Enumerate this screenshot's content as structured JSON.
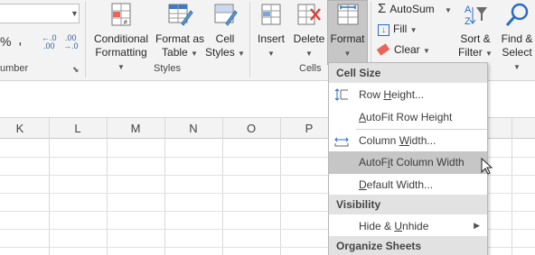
{
  "ribbon": {
    "number": {
      "percent": "%",
      "comma": ",",
      "increase_decimal_top": "←.0",
      "increase_decimal_bottom": ".00",
      "decrease_decimal_top": ".00",
      "decrease_decimal_bottom": "→.0",
      "group_label": "umber"
    },
    "styles": {
      "conditional_formatting": [
        "Conditional",
        "Formatting"
      ],
      "format_as_table": [
        "Format as",
        "Table"
      ],
      "cell_styles": [
        "Cell",
        "Styles"
      ],
      "group_label": "Styles"
    },
    "cells": {
      "insert": "Insert",
      "delete": "Delete",
      "format": "Format",
      "group_label": "Cells"
    },
    "editing": {
      "autosum": "AutoSum",
      "fill": "Fill",
      "clear": "Clear",
      "sort_filter": [
        "Sort &",
        "Filter"
      ],
      "find_select": [
        "Find &",
        "Select"
      ]
    }
  },
  "columns": [
    "K",
    "L",
    "M",
    "N",
    "O",
    "P"
  ],
  "format_menu": {
    "section_cell_size": "Cell Size",
    "row_height": {
      "pre": "Row ",
      "key": "H",
      "post": "eight..."
    },
    "autofit_row_height": {
      "pre": "",
      "key": "A",
      "post": "utoFit Row Height"
    },
    "column_width": {
      "pre": "Column ",
      "key": "W",
      "post": "idth..."
    },
    "autofit_column_width": {
      "pre": "AutoF",
      "key": "i",
      "post": "t Column Width"
    },
    "default_width": {
      "pre": "",
      "key": "D",
      "post": "efault Width..."
    },
    "section_visibility": "Visibility",
    "hide_unhide": {
      "pre": "Hide & ",
      "key": "U",
      "post": "nhide"
    },
    "section_organize": "Organize Sheets"
  },
  "colors": {
    "accent_blue": "#2b6cc4",
    "delete_red": "#d9413a",
    "highlight": "#c6c6c6"
  }
}
